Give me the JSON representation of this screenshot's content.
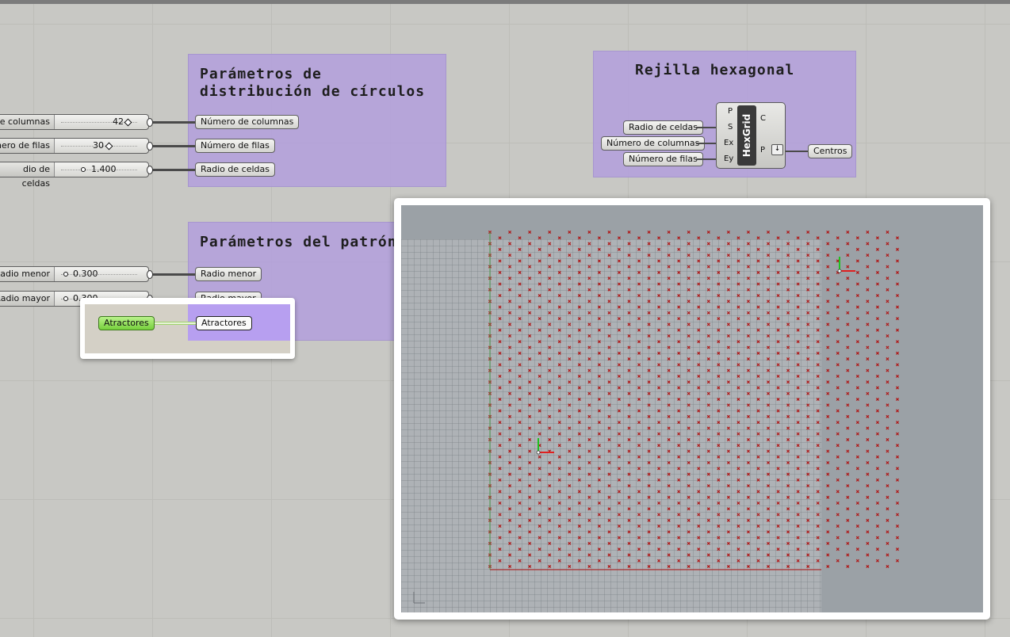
{
  "groups": {
    "distribucion": {
      "title": "Parámetros de\ndistribución de círculos"
    },
    "patron": {
      "title": "Parámetros del patrón"
    },
    "rejilla": {
      "title": "Rejilla hexagonal"
    }
  },
  "sliders": [
    {
      "label": "de columnas",
      "value": "42"
    },
    {
      "label": "mero de filas",
      "value": "30"
    },
    {
      "label": "dio de celdas",
      "value": "1.400"
    },
    {
      "label": "Radio menor",
      "value": "0.300"
    },
    {
      "label": "Radio mayor",
      "value": "0.300"
    }
  ],
  "params": {
    "numero_columnas": "Número de columnas",
    "numero_filas": "Número de filas",
    "radio_celdas": "Radio de celdas",
    "radio_menor": "Radio menor",
    "radio_mayor": "Radio mayor",
    "atractores": "Atractores",
    "atractores_source": "Atractores"
  },
  "hexgrid": {
    "name": "HexGrid",
    "inputs": [
      "P",
      "S",
      "Ex",
      "Ey"
    ],
    "outputs": [
      "C",
      "P"
    ],
    "input_params": [
      "Radio de celdas",
      "Número de columnas",
      "Número de filas"
    ],
    "output_param": "Centros"
  },
  "viewport": {
    "point_color": "#b01818",
    "grid": {
      "columns": 42,
      "rows": 30
    }
  }
}
